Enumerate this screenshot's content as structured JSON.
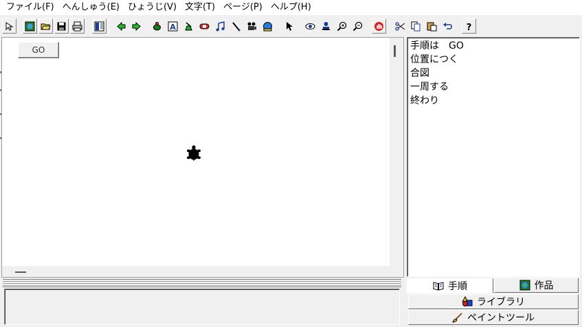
{
  "menu": [
    {
      "label": "ファイル(F)"
    },
    {
      "label": "へんしゅう(E)"
    },
    {
      "label": "ひょうじ(V)"
    },
    {
      "label": "文字(T)"
    },
    {
      "label": "ページ(P)"
    },
    {
      "label": "ヘルプ(H)"
    }
  ],
  "toolbar_icons": [
    "arrow-cursor-icon",
    "globe-icon",
    "open-folder-icon",
    "save-disk-icon",
    "print-icon",
    "pages-icon",
    "back-arrow-icon",
    "forward-arrow-icon",
    "turtle-stamp-icon",
    "text-box-icon",
    "gauge-icon",
    "capsule-icon",
    "music-note-icon",
    "pen-icon",
    "movie-camera-icon",
    "globe-paint-icon",
    "pointer-icon",
    "eye-icon",
    "stamp-icon",
    "zoom-in-icon",
    "zoom-out-icon",
    "stop-hand-icon",
    "scissors-icon",
    "copy-icon",
    "paste-icon",
    "undo-icon",
    "help-icon"
  ],
  "canvas": {
    "go_button_label": "GO"
  },
  "procedure_lines": [
    "手順は　GO",
    "位置につく",
    "合図",
    "一周する",
    "終わり"
  ],
  "tabs": {
    "procedure": "手順",
    "works": "作品",
    "library": "ライブラリ",
    "paint_tool": "ペイントツール"
  }
}
